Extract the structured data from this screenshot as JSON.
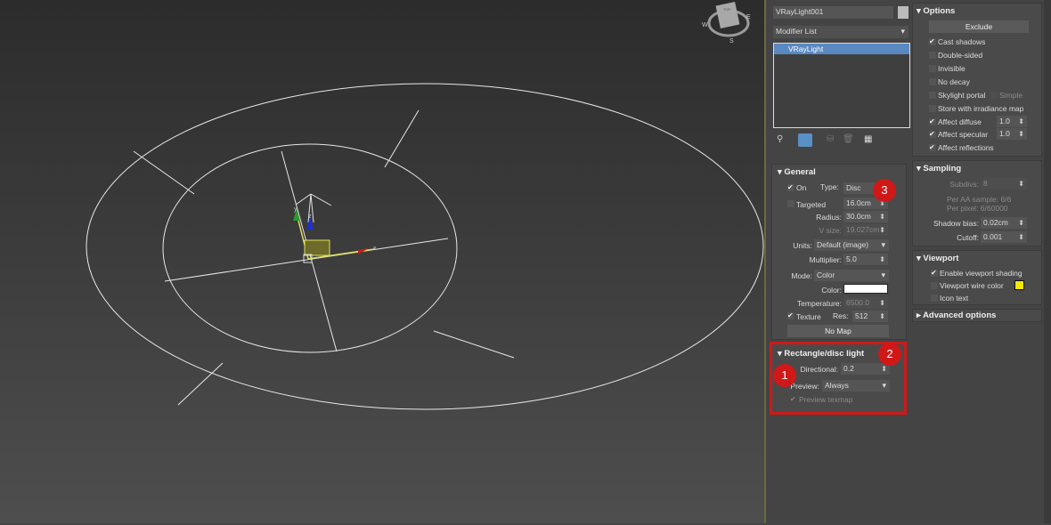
{
  "viewport": {
    "compass": {
      "w": "W",
      "e": "E",
      "s": "S",
      "top": "TOP"
    },
    "gizmo_x": "x",
    "gizmo_y": "y",
    "gizmo_z": "z"
  },
  "modify": {
    "object_name": "VRayLight001",
    "modifier_list": "Modifier List",
    "stack": [
      "VRayLight"
    ]
  },
  "general": {
    "title": "General",
    "on": "On",
    "type_label": "Type:",
    "type_value": "Disc",
    "targeted": "Targeted",
    "target_value": "16.0cm",
    "radius_label": "Radius:",
    "radius_value": "30.0cm",
    "vsize_label": "V size:",
    "vsize_value": "19.027cm",
    "units_label": "Units:",
    "units_value": "Default (image)",
    "multiplier_label": "Multiplier:",
    "multiplier_value": "5.0",
    "mode_label": "Mode:",
    "mode_value": "Color",
    "color_label": "Color:",
    "temperature_label": "Temperature:",
    "temperature_value": "6500.0",
    "texture": "Texture",
    "res_label": "Res:",
    "res_value": "512",
    "no_map": "No Map"
  },
  "rect_disc": {
    "title": "Rectangle/disc light",
    "directional_label": "Directional:",
    "directional_value": "0.2",
    "preview_label": "Preview:",
    "preview_value": "Always",
    "preview_texmap": "Preview texmap"
  },
  "options": {
    "title": "Options",
    "exclude": "Exclude",
    "cast_shadows": "Cast shadows",
    "double_sided": "Double-sided",
    "invisible": "Invisible",
    "no_decay": "No decay",
    "skylight_portal": "Skylight portal",
    "simple": "Simple",
    "store_irradiance": "Store with irradiance map",
    "affect_diffuse": "Affect diffuse",
    "affect_diffuse_value": "1.0",
    "affect_specular": "Affect specular",
    "affect_specular_value": "1.0",
    "affect_reflections": "Affect reflections"
  },
  "sampling": {
    "title": "Sampling",
    "subdivs_label": "Subdivs:",
    "subdivs_value": "8",
    "per_aa": "Per AA sample: 6/6",
    "per_pixel": "Per pixel: 6/60000",
    "shadow_bias_label": "Shadow bias:",
    "shadow_bias_value": "0.02cm",
    "cutoff_label": "Cutoff:",
    "cutoff_value": "0.001"
  },
  "viewport_rollout": {
    "title": "Viewport",
    "enable_shading": "Enable viewport shading",
    "wire_color": "Viewport wire color",
    "icon_text": "Icon text",
    "wire_color_hex": "#f5e800"
  },
  "advanced": {
    "title": "Advanced options"
  },
  "annotations": {
    "b1": "1",
    "b2": "2",
    "b3": "3",
    "highlight_color": "#d01818"
  }
}
